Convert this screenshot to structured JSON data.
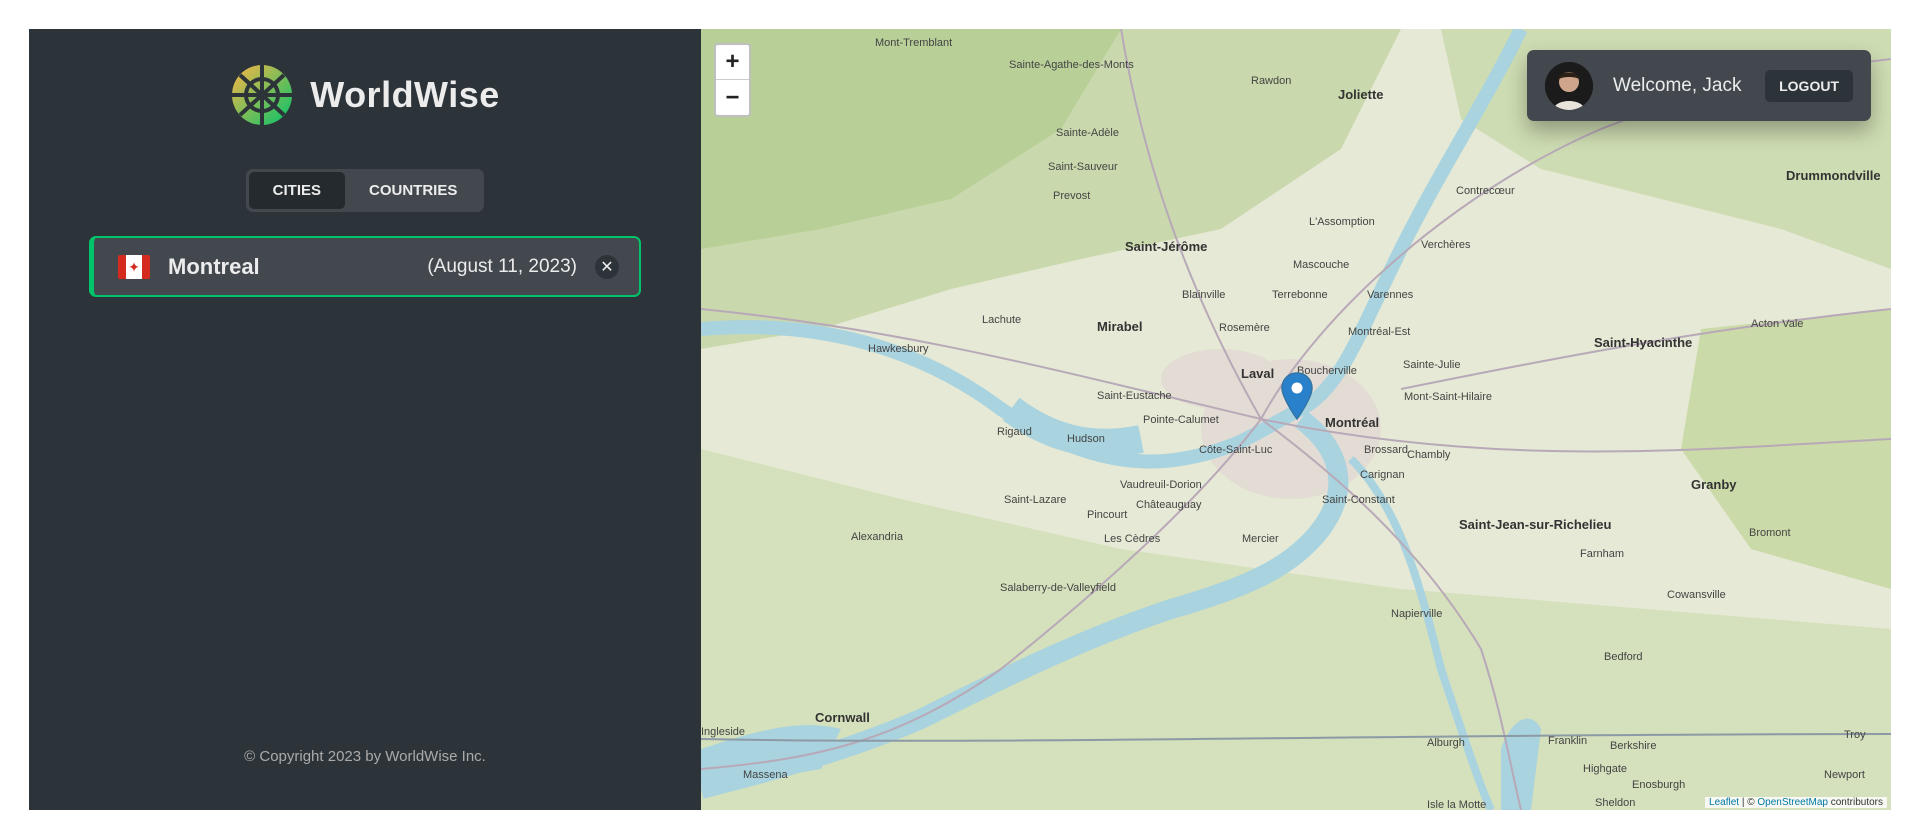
{
  "app": {
    "name": "WorldWise"
  },
  "tabs": {
    "cities": "Cities",
    "countries": "Countries"
  },
  "cities": [
    {
      "name": "Montreal",
      "date": "(August 11, 2023)",
      "flag": "flag-canada"
    }
  ],
  "footer": {
    "copyright": "© Copyright 2023 by WorldWise Inc."
  },
  "map": {
    "zoom_in": "+",
    "zoom_out": "−",
    "attribution_leaflet": "Leaflet",
    "attribution_sep": " | © ",
    "attribution_osm": "OpenStreetMap",
    "attribution_tail": " contributors",
    "places": [
      {
        "name": "Mont-Tremblant"
      },
      {
        "name": "Sainte-Agathe-des-Monts"
      },
      {
        "name": "Rawdon"
      },
      {
        "name": "Joliette"
      },
      {
        "name": "Sainte-Adèle"
      },
      {
        "name": "Saint-Sauveur"
      },
      {
        "name": "Prevost"
      },
      {
        "name": "Contrecœur"
      },
      {
        "name": "Drummondville"
      },
      {
        "name": "L'Assomption"
      },
      {
        "name": "Saint-Jérôme"
      },
      {
        "name": "Verchères"
      },
      {
        "name": "Mascouche"
      },
      {
        "name": "Blainville"
      },
      {
        "name": "Terrebonne"
      },
      {
        "name": "Varennes"
      },
      {
        "name": "Lachute"
      },
      {
        "name": "Mirabel"
      },
      {
        "name": "Rosemère"
      },
      {
        "name": "Montréal-Est"
      },
      {
        "name": "Saint-Hyacinthe"
      },
      {
        "name": "Acton Vale"
      },
      {
        "name": "Hawkesbury"
      },
      {
        "name": "Laval"
      },
      {
        "name": "Boucherville"
      },
      {
        "name": "Sainte-Julie"
      },
      {
        "name": "Saint-Eustache"
      },
      {
        "name": "Mont-Saint-Hilaire"
      },
      {
        "name": "Pointe-Calumet"
      },
      {
        "name": "Montréal"
      },
      {
        "name": "Rigaud"
      },
      {
        "name": "Hudson"
      },
      {
        "name": "Côte-Saint-Luc"
      },
      {
        "name": "Brossard"
      },
      {
        "name": "Chambly"
      },
      {
        "name": "Carignan"
      },
      {
        "name": "Vaudreuil-Dorion"
      },
      {
        "name": "Granby"
      },
      {
        "name": "Saint-Lazare"
      },
      {
        "name": "Châteauguay"
      },
      {
        "name": "Saint-Constant"
      },
      {
        "name": "Pincourt"
      },
      {
        "name": "Saint-Jean-sur-Richelieu"
      },
      {
        "name": "Bromont"
      },
      {
        "name": "Alexandria"
      },
      {
        "name": "Les Cèdres"
      },
      {
        "name": "Mercier"
      },
      {
        "name": "Farnham"
      },
      {
        "name": "Salaberry-de-Valleyfield"
      },
      {
        "name": "Cowansville"
      },
      {
        "name": "Napierville"
      },
      {
        "name": "Bedford"
      },
      {
        "name": "Cornwall"
      },
      {
        "name": "Ingleside"
      },
      {
        "name": "Alburgh"
      },
      {
        "name": "Franklin"
      },
      {
        "name": "Berkshire"
      },
      {
        "name": "Troy"
      },
      {
        "name": "Massena"
      },
      {
        "name": "Highgate"
      },
      {
        "name": "Enosburgh"
      },
      {
        "name": "Newport"
      },
      {
        "name": "Isle la Motte"
      },
      {
        "name": "Sheldon"
      }
    ]
  },
  "user": {
    "welcome": "Welcome, Jack",
    "logout": "Logout"
  },
  "colors": {
    "brand_green": "#00c46a",
    "sidebar_bg": "#2d3439",
    "panel_bg": "#42484d",
    "text": "#ececec",
    "marker": "#2a81cb"
  }
}
